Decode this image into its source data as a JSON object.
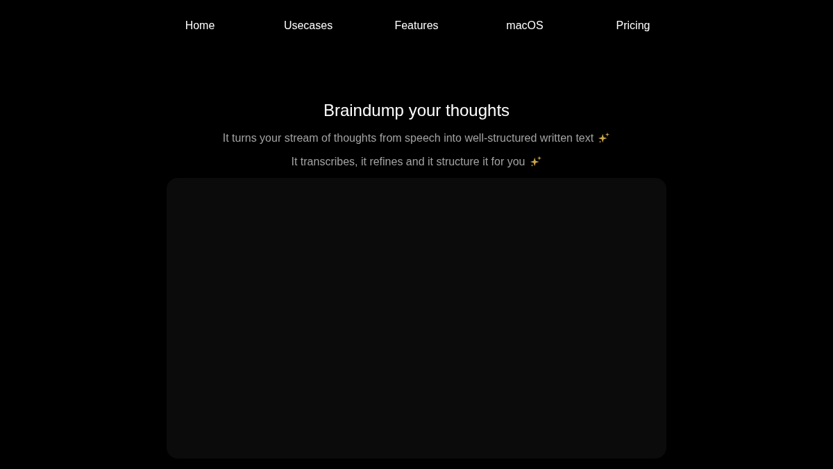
{
  "nav": {
    "links": [
      "Home",
      "Usecases",
      "Features",
      "macOS",
      "Pricing"
    ]
  },
  "hero": {
    "title": "Braindump your thoughts",
    "lines": [
      "It turns your stream of thoughts from speech into well-structured written text",
      "It transcribes, it refines and it structure it for you"
    ]
  }
}
